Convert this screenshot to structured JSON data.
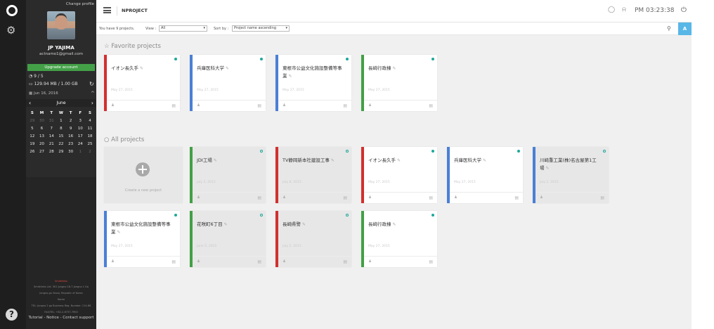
{
  "sidebar": {
    "change_profile": "Change profile",
    "user_name": "JP YAJIMA",
    "user_email": "actnamo1@gmail.com",
    "upgrade_label": "Upgrade account",
    "projects_stat": "9 / 5",
    "storage_stat": "129.94 MB / 1.00 GB",
    "calendar_date": "Jun 16, 2016",
    "calendar_month": "June",
    "weekday_headers": [
      "S",
      "M",
      "T",
      "W",
      "T",
      "F",
      "S"
    ],
    "calendar_rows": [
      [
        "29",
        "30",
        "31",
        "1",
        "2",
        "3",
        "4"
      ],
      [
        "5",
        "6",
        "7",
        "8",
        "9",
        "10",
        "11"
      ],
      [
        "12",
        "13",
        "14",
        "15",
        "16",
        "17",
        "18"
      ],
      [
        "19",
        "20",
        "21",
        "22",
        "23",
        "24",
        "25"
      ],
      [
        "26",
        "27",
        "28",
        "29",
        "30",
        "1",
        "2"
      ]
    ],
    "footer_lines": [
      "Smilelinks Ltd. 301 Jongno 18-7 Jongno 1 Ga",
      "Jongno-gu Seoul, Republic of Korea",
      "Korea",
      "TEL: Jongno 2 ga Business Reg. Number: 114-86",
      "FAX/TEL: +82-2-6737-7900"
    ],
    "footer_brand": "Smilelinks",
    "footer_links": "Tutorial - Notice - Contact support"
  },
  "topbar": {
    "app_title": "NPROJECT",
    "clock": "PM 03:23:38"
  },
  "filterbar": {
    "summary": "You have 9 projects.",
    "view_label": "View :",
    "view_value": "All",
    "sort_label": "Sort by :",
    "sort_value": "Project name ascending",
    "az_label": "A"
  },
  "favorites": {
    "title": "Favorite projects",
    "cards": [
      {
        "name": "イオン長久手",
        "date": "May 27, 2015",
        "color": "red"
      },
      {
        "name": "兵庫医科大学",
        "date": "May 27, 2015",
        "color": "blue"
      },
      {
        "name": "東根市公益文化施設整備等事業",
        "date": "May 27, 2015",
        "color": "blue"
      },
      {
        "name": "長崎行政棟",
        "date": "May 27, 2015",
        "color": "green"
      }
    ]
  },
  "all_projects": {
    "title": "All projects",
    "new_project_label": "Create a new project",
    "cards": [
      {
        "name": "JDI工場",
        "date": "July 2, 2015",
        "color": "green",
        "grey": true
      },
      {
        "name": "TV静岡新本社建設工事",
        "date": "July 8, 2015",
        "color": "red",
        "grey": true
      },
      {
        "name": "イオン長久手",
        "date": "May 27, 2015",
        "color": "red",
        "grey": false
      },
      {
        "name": "兵庫医科大学",
        "date": "May 27, 2015",
        "color": "blue",
        "grey": false
      },
      {
        "name": "川崎重工業(株)名古屋第1工場",
        "date": "July 2, 2015",
        "color": "blue",
        "grey": true
      },
      {
        "name": "東根市公益文化施設整備等事業",
        "date": "May 27, 2015",
        "color": "blue",
        "grey": false
      },
      {
        "name": "花咲町6丁目",
        "date": "June 5, 2015",
        "color": "green",
        "grey": true
      },
      {
        "name": "長崎県警",
        "date": "July 5, 2015",
        "color": "red",
        "grey": true
      },
      {
        "name": "長崎行政棟",
        "date": "May 27, 2015",
        "color": "green",
        "grey": false
      }
    ]
  }
}
